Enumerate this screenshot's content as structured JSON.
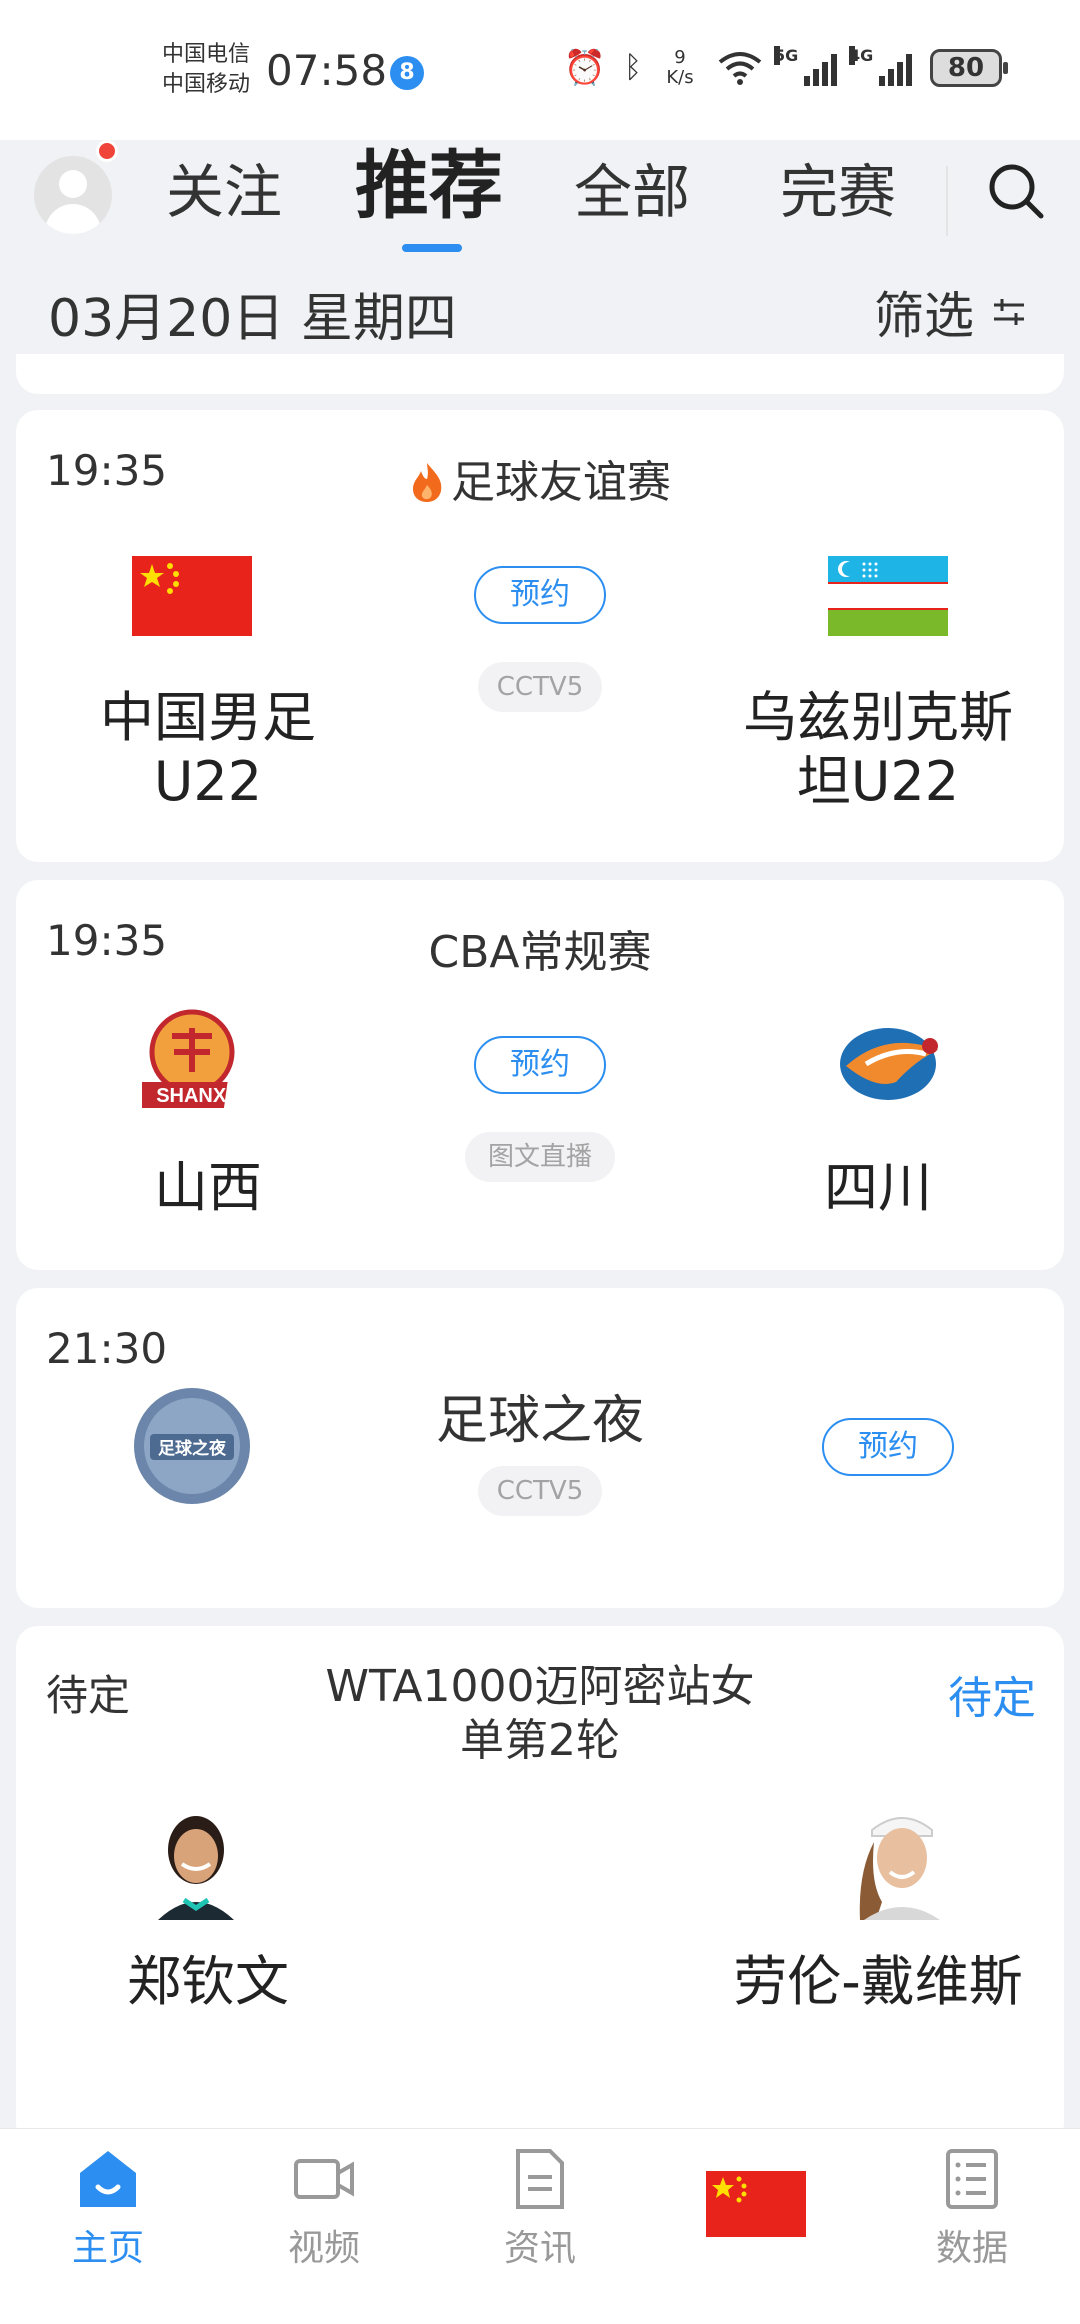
{
  "status": {
    "carrier_1": "中国电信",
    "carrier_2": "中国移动",
    "time": "07:58",
    "notif_badge": "8",
    "net_speed_value": "9",
    "net_speed_unit": "K/s",
    "battery": "80",
    "signal_1_tag": "5G",
    "signal_2_tag": "4G"
  },
  "nav": {
    "tabs": [
      "关注",
      "推荐",
      "全部",
      "完赛"
    ],
    "active_tab": "推荐"
  },
  "date_bar": {
    "date": "03月20日 星期四",
    "filter_label": "筛选"
  },
  "matches": [
    {
      "time": "19:35",
      "league": "足球友谊赛",
      "hot": true,
      "home": "中国男足U22",
      "away": "乌兹别克斯坦U22",
      "reserve_label": "预约",
      "channel": "CCTV5"
    },
    {
      "time": "19:35",
      "league": "CBA常规赛",
      "home": "山西",
      "away": "四川",
      "reserve_label": "预约",
      "channel": "图文直播",
      "home_logo_text": "SHANXI"
    },
    {
      "time": "21:30",
      "program": "足球之夜",
      "reserve_label": "预约",
      "channel": "CCTV5",
      "logo_text": "足球之夜"
    },
    {
      "time": "待定",
      "league": "WTA1000迈阿密站女单第2轮",
      "status": "待定",
      "home": "郑钦文",
      "away": "劳伦-戴维斯"
    }
  ],
  "bottom_nav": {
    "items": [
      {
        "label": "主页",
        "icon": "home-icon",
        "active": true
      },
      {
        "label": "视频",
        "icon": "video-icon"
      },
      {
        "label": "资讯",
        "icon": "news-icon"
      },
      {
        "label": "",
        "icon": "china-flag-icon"
      },
      {
        "label": "数据",
        "icon": "data-icon"
      }
    ]
  },
  "colors": {
    "accent": "#2b8ef0",
    "hot": "#f26b1d",
    "badge_red": "#f0443a",
    "background": "#f1f2f5"
  }
}
